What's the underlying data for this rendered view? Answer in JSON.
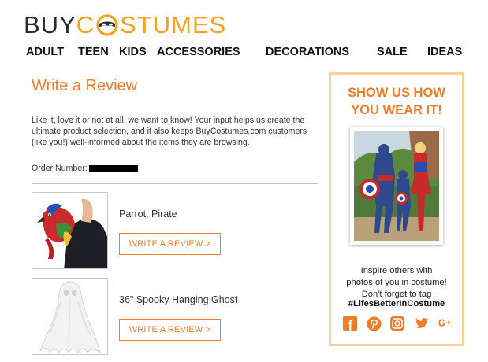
{
  "logo": {
    "part1": "BUY",
    "part2_prefix": "C",
    "part2_suffix": "STUMES"
  },
  "nav": {
    "items": [
      {
        "label": "ADULT"
      },
      {
        "label": "TEEN"
      },
      {
        "label": "KIDS"
      },
      {
        "label": "ACCESSORIES"
      },
      {
        "label": "DECORATIONS"
      },
      {
        "label": "SALE"
      },
      {
        "label": "IDEAS"
      }
    ]
  },
  "review": {
    "title": "Write a Review",
    "intro": "Like it, love it or not at all, we want to know! Your input helps us create the ultimate product selection, and it also keeps BuyCostumes.com customers (like you!) well-informed about the items they are browsing.",
    "order_label": "Order Number:"
  },
  "products": [
    {
      "name": "Parrot, Pirate",
      "button": "WRITE A REVIEW >",
      "image_icon": "parrot-costume-image"
    },
    {
      "name": "36\" Spooky Hanging Ghost",
      "button": "WRITE A REVIEW >",
      "image_icon": "ghost-decoration-image"
    }
  ],
  "promo": {
    "title_line1": "SHOW US HOW",
    "title_line2": "YOU WEAR IT!",
    "text_line1": "Inspire others with",
    "text_line2": "photos of you in costume!",
    "text_line3": "Don't forget to tag",
    "hashtag": "#LifesBetterInCostume",
    "social_icons": [
      "facebook-icon",
      "pinterest-icon",
      "instagram-icon",
      "twitter-icon",
      "google-plus-icon"
    ]
  },
  "colors": {
    "accent": "#f07c2b",
    "logo_orange": "#f2a21e",
    "promo_border": "#f7d09a"
  }
}
